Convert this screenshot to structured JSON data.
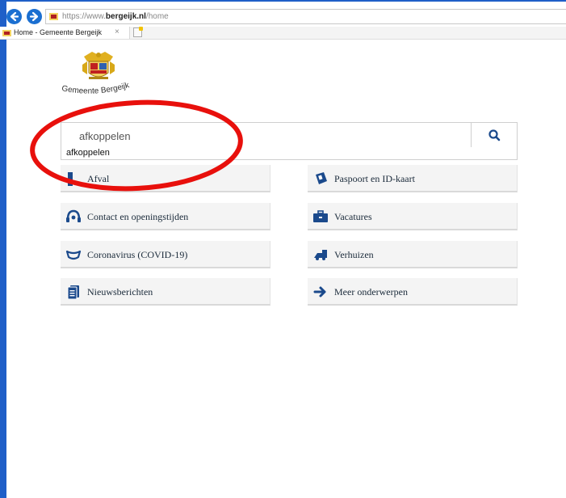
{
  "browser": {
    "url_prefix": "https://www.",
    "url_domain": "bergeijk.nl",
    "url_path": "/home",
    "tab_title": "Home - Gemeente Bergeijk",
    "tab_close": "×",
    "back_icon": "arrow-left-icon",
    "forward_icon": "arrow-right-icon"
  },
  "logo": {
    "name": "Gemeente Bergeijk"
  },
  "search": {
    "value": "afkoppelen",
    "suggestion": "afkoppelen",
    "accent": "#1b4a8c"
  },
  "tiles": [
    {
      "label": "Afval",
      "icon": "trash-icon"
    },
    {
      "label": "Paspoort en ID-kaart",
      "icon": "id-card-icon"
    },
    {
      "label": "Contact en openingstijden",
      "icon": "headset-icon"
    },
    {
      "label": "Vacatures",
      "icon": "briefcase-icon"
    },
    {
      "label": "Coronavirus (COVID-19)",
      "icon": "mask-icon"
    },
    {
      "label": "Verhuizen",
      "icon": "truck-icon"
    },
    {
      "label": "Nieuwsberichten",
      "icon": "newspaper-icon"
    },
    {
      "label": "Meer onderwerpen",
      "icon": "arrow-right-icon"
    }
  ],
  "colors": {
    "icon": "#1b4a8c",
    "annotation": "#e8100c",
    "chrome_blue": "#1b6fd1"
  }
}
